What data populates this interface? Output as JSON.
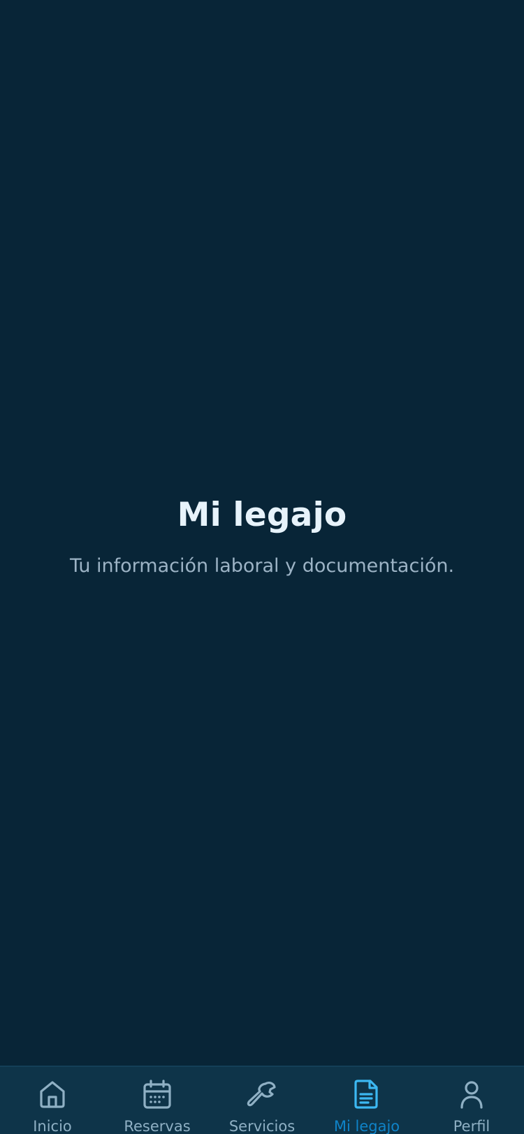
{
  "main": {
    "title": "Mi legajo",
    "subtitle": "Tu información laboral y documentación."
  },
  "tabbar": {
    "active_color": "#3cb8f2",
    "inactive_color": "#8fb0c4",
    "items": [
      {
        "label": "Inicio",
        "icon": "home-icon",
        "active": false
      },
      {
        "label": "Reservas",
        "icon": "calendar-icon",
        "active": false
      },
      {
        "label": "Servicios",
        "icon": "wrench-icon",
        "active": false
      },
      {
        "label": "Mi legajo",
        "icon": "document-icon",
        "active": true
      },
      {
        "label": "Perfil",
        "icon": "user-icon",
        "active": false
      }
    ]
  }
}
